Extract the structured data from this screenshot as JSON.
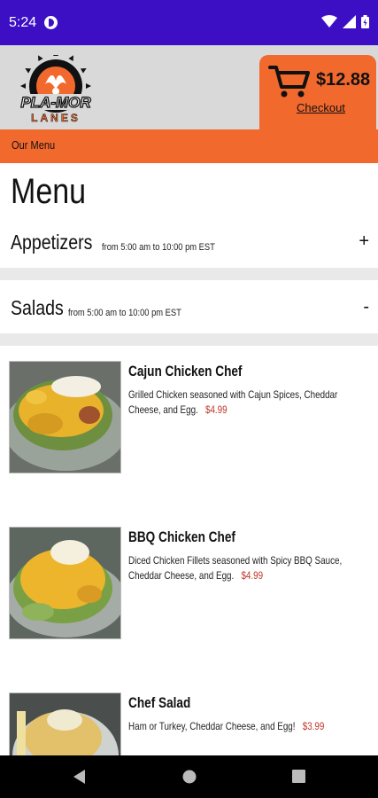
{
  "status_bar": {
    "time": "5:24"
  },
  "header": {
    "logo_text": "PLA-MOR",
    "logo_subtext": "LANES",
    "cart_total": "$12.88",
    "checkout_label": "Checkout"
  },
  "breadcrumb": "Our Menu",
  "page_title": "Menu",
  "sections": [
    {
      "name": "Appetizers",
      "hours": "from 5:00 am to 10:00 pm EST",
      "toggle": "+"
    },
    {
      "name": "Salads",
      "hours": "from 5:00 am to 10:00 pm EST",
      "toggle": "-"
    }
  ],
  "items": [
    {
      "name": "Cajun Chicken Chef",
      "description": "Grilled Chicken seasoned with Cajun Spices, Cheddar Cheese, and Egg.",
      "price": "$4.99"
    },
    {
      "name": "BBQ Chicken Chef",
      "description": "Diced Chicken Fillets seasoned with Spicy BBQ Sauce, Cheddar Cheese, and Egg.",
      "price": "$4.99"
    },
    {
      "name": "Chef Salad",
      "description": "Ham or Turkey, Cheddar Cheese, and Egg!",
      "price": "$3.99"
    }
  ],
  "colors": {
    "status_bar": "#3d0fc4",
    "accent_orange": "#f2692e",
    "price_red": "#c0392b",
    "header_gray": "#d9d9d9"
  }
}
